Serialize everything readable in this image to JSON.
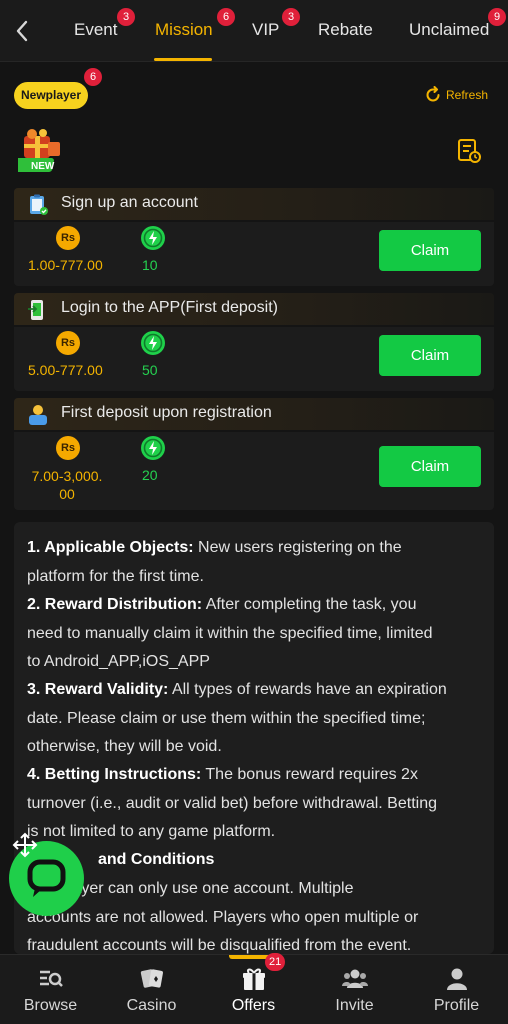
{
  "tabs": [
    {
      "label": "Event",
      "badge": "3"
    },
    {
      "label": "Mission",
      "badge": "6"
    },
    {
      "label": "VIP",
      "badge": "3"
    },
    {
      "label": "Rebate",
      "badge": ""
    },
    {
      "label": "Unclaimed",
      "badge": "9"
    }
  ],
  "active_tab": "Mission",
  "newplayer": {
    "label": "Newplayer",
    "badge": "6"
  },
  "refresh_label": "Refresh",
  "new_tag": "NEW",
  "coin_symbol": "Rs",
  "tasks": [
    {
      "title": "Sign up an account",
      "amount": "1.00-777.00",
      "points": "10",
      "claim": "Claim"
    },
    {
      "title": "Login to the APP(First deposit)",
      "amount": "5.00-777.00",
      "points": "50",
      "claim": "Claim"
    },
    {
      "title": "First deposit upon registration",
      "amount_line1": "7.00-3,000.",
      "amount_line2": "00",
      "points": "20",
      "claim": "Claim"
    }
  ],
  "rules": [
    {
      "heading": "1. Applicable Objects:",
      "text_a": " New users registering on the",
      "text_b": "platform for the first time."
    },
    {
      "heading": "2. Reward Distribution:",
      "text_a": " After completing the task, you",
      "text_b": "need to manually claim it within the specified time, limited",
      "text_c": "to Android_APP,iOS_APP"
    },
    {
      "heading": "3. Reward Validity:",
      "text_a": " All types of rewards have an expiration",
      "text_b": "date. Please claim or use them within the specified time;",
      "text_c": "otherwise, they will be void."
    },
    {
      "heading": "4. Betting Instructions:",
      "text_a": " The bonus reward requires 2x",
      "text_b": "turnover (i.e., audit or valid bet) before withdrawal. Betting",
      "text_c": "is not limited to any game platform."
    },
    {
      "heading": "and Conditions"
    },
    {
      "text_a": "player can only use one account. Multiple",
      "text_b": "accounts are not allowed. Players who open multiple or",
      "text_c": "fraudulent accounts will be disqualified from the event."
    }
  ],
  "bottom_nav": [
    {
      "label": "Browse"
    },
    {
      "label": "Casino"
    },
    {
      "label": "Offers",
      "badge": "21"
    },
    {
      "label": "Invite"
    },
    {
      "label": "Profile"
    }
  ],
  "active_nav": "Offers",
  "colors": {
    "accent": "#f4b400",
    "claim": "#13c944",
    "badge": "#e0203a",
    "background": "#141414"
  }
}
